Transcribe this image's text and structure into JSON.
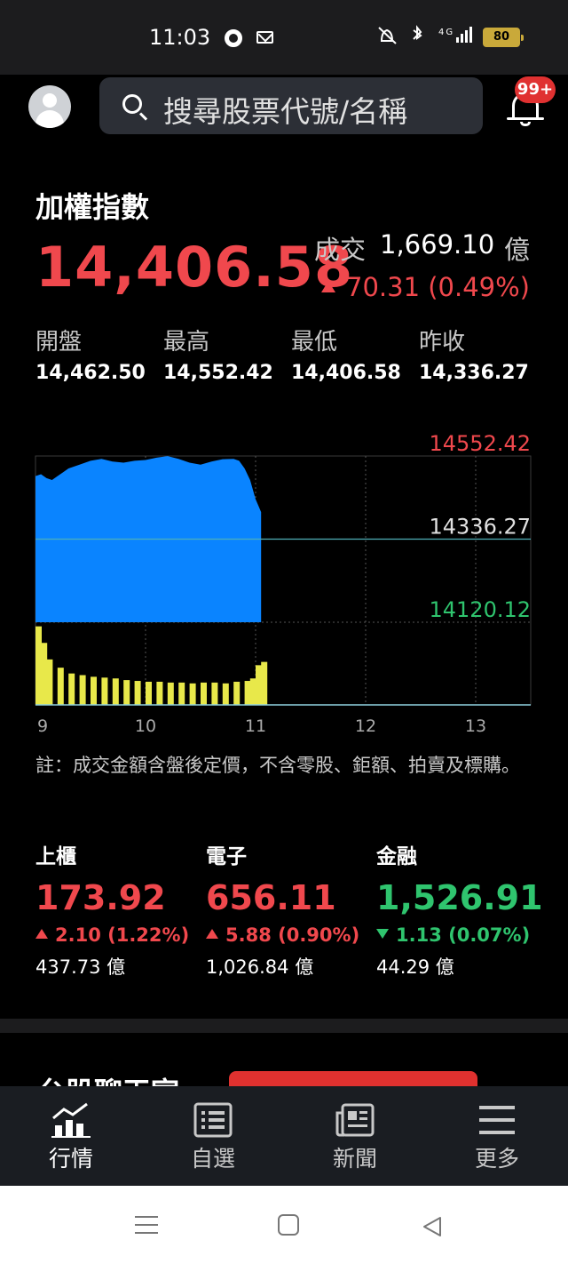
{
  "status_bar": {
    "time": "11:03",
    "network": "4G",
    "battery": "80"
  },
  "header": {
    "search_placeholder": "搜尋股票代號/名稱",
    "notification_badge": "99+"
  },
  "index": {
    "title": "加權指數",
    "value": "14,406.58",
    "volume_label": "成交",
    "volume_value": "1,669.10",
    "volume_unit": "億",
    "change": "70.31 (0.49%)",
    "direction": "up",
    "stats": [
      {
        "label": "開盤",
        "value": "14,462.50"
      },
      {
        "label": "最高",
        "value": "14,552.42"
      },
      {
        "label": "最低",
        "value": "14,406.58"
      },
      {
        "label": "昨收",
        "value": "14,336.27"
      }
    ]
  },
  "chart_data": {
    "type": "area",
    "x_unit": "hour",
    "x_ticks": [
      "9",
      "10",
      "11",
      "12",
      "13"
    ],
    "y_labels": [
      "14552.42",
      "14336.27",
      "14120.12"
    ],
    "ylim": [
      14120.12,
      14552.42
    ],
    "reference_line": 14336.27,
    "series": [
      {
        "type": "area",
        "x": [
          9.0,
          9.05,
          9.1,
          9.15,
          9.2,
          9.25,
          9.3,
          9.35,
          9.4,
          9.5,
          9.6,
          9.7,
          9.8,
          9.9,
          10.0,
          10.1,
          10.2,
          10.3,
          10.4,
          10.5,
          10.6,
          10.7,
          10.8,
          10.85,
          10.9,
          10.95,
          11.0,
          11.03,
          11.05
        ],
        "values": [
          14500,
          14505,
          14495,
          14490,
          14500,
          14510,
          14520,
          14525,
          14530,
          14540,
          14545,
          14538,
          14535,
          14540,
          14542,
          14548,
          14552,
          14545,
          14535,
          14530,
          14538,
          14544,
          14545,
          14540,
          14520,
          14490,
          14440,
          14420,
          14406.58
        ]
      },
      {
        "type": "bar",
        "x": [
          9.0,
          9.05,
          9.1,
          9.2,
          9.3,
          9.4,
          9.5,
          9.6,
          9.7,
          9.8,
          9.9,
          10.0,
          10.1,
          10.2,
          10.3,
          10.4,
          10.5,
          10.6,
          10.7,
          10.8,
          10.9,
          10.95,
          11.0,
          11.03,
          11.05
        ],
        "values": [
          95,
          75,
          55,
          45,
          38,
          36,
          34,
          33,
          32,
          30,
          29,
          28,
          28,
          27,
          27,
          26,
          27,
          27,
          26,
          28,
          29,
          32,
          48,
          38,
          52
        ]
      }
    ]
  },
  "note": "註：成交金額含盤後定價，不含零股、鉅額、拍賣及標購。",
  "sub_indices": [
    {
      "name": "上櫃",
      "value": "173.92",
      "change": "2.10 (1.22%)",
      "direction": "up",
      "volume": "437.73 億"
    },
    {
      "name": "電子",
      "value": "656.11",
      "change": "5.88 (0.90%)",
      "direction": "up",
      "volume": "1,026.84 億"
    },
    {
      "name": "金融",
      "value": "1,526.91",
      "change": "1.13 (0.07%)",
      "direction": "down",
      "volume": "44.29 億"
    }
  ],
  "section_peek": {
    "title": "台股聊天室"
  },
  "bottom_nav": [
    {
      "label": "行情",
      "icon": "chart-icon",
      "active": true
    },
    {
      "label": "自選",
      "icon": "list-icon",
      "active": false
    },
    {
      "label": "新聞",
      "icon": "news-icon",
      "active": false
    },
    {
      "label": "更多",
      "icon": "menu-icon",
      "active": false
    }
  ],
  "colors": {
    "up": "#f0484d",
    "down": "#2fc46e",
    "area": "#0a84ff",
    "volume": "#e8e84a",
    "reference": "#4fb0b8"
  }
}
